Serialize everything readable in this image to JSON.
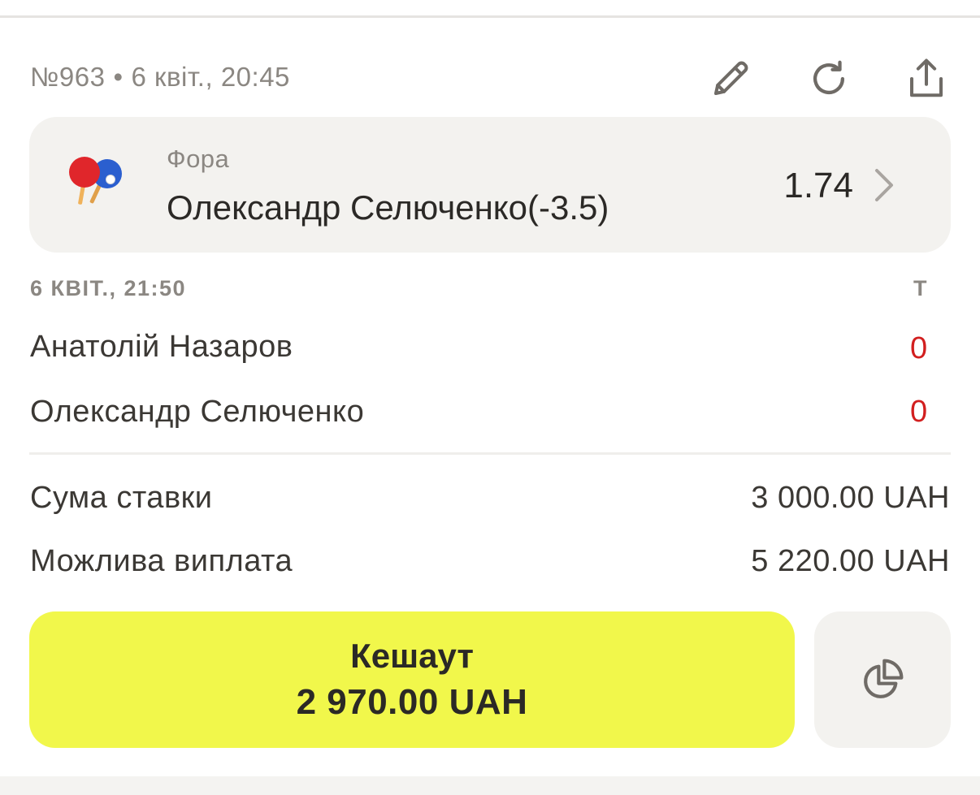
{
  "header": {
    "bet_number": "№963",
    "separator": "•",
    "placed_at": "6 квіт., 20:45",
    "icons": [
      "pencil-icon",
      "refresh-icon",
      "share-icon"
    ]
  },
  "bet": {
    "sport_icon": "table-tennis-icon",
    "market": "Фора",
    "selection": "Олександр Селюченко(-3.5)",
    "odds": "1.74"
  },
  "event": {
    "start": "6 КВІТ., 21:50",
    "score_column": "Т",
    "players": [
      {
        "name": "Анатолій Назаров",
        "score": "0"
      },
      {
        "name": "Олександр Селюченко",
        "score": "0"
      }
    ]
  },
  "summary": {
    "stake_label": "Сума ставки",
    "stake_value": "3 000.00 UAH",
    "payout_label": "Можлива виплата",
    "payout_value": "5 220.00 UAH"
  },
  "cashout": {
    "label": "Кешаут",
    "amount": "2 970.00 UAH"
  },
  "colors": {
    "accent_yellow": "#f1f74b",
    "score_red": "#d21f1f",
    "card_bg": "#f3f2ef",
    "muted_text": "#8b8782"
  }
}
